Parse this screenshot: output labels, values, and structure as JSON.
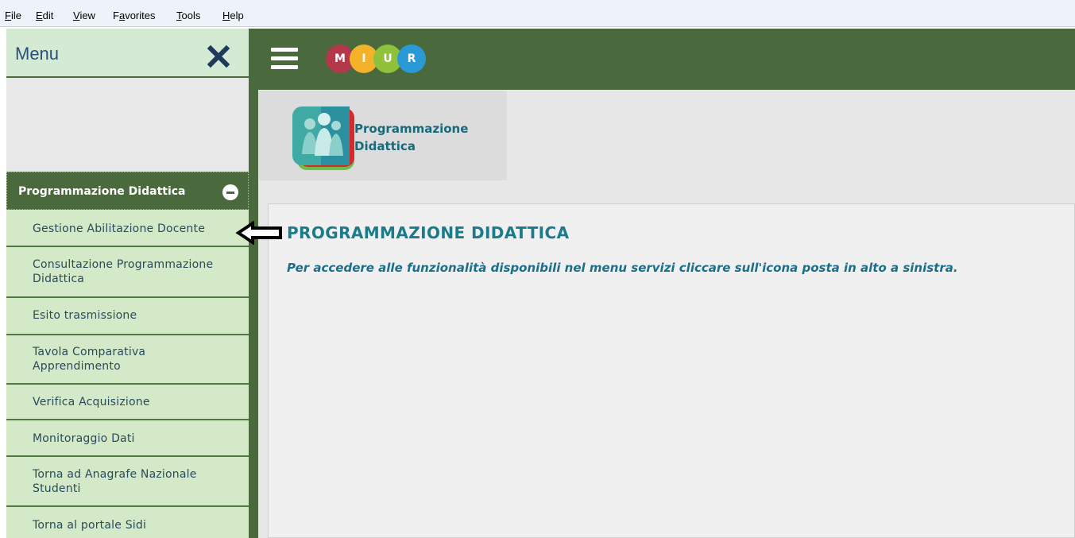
{
  "browser_menu": {
    "items": [
      {
        "accel": "F",
        "rest": "ile"
      },
      {
        "accel": "E",
        "rest": "dit"
      },
      {
        "accel": "V",
        "rest": "iew"
      },
      {
        "pre": "F",
        "accel": "a",
        "rest": "vorites"
      },
      {
        "accel": "T",
        "rest": "ools"
      },
      {
        "accel": "H",
        "rest": "elp"
      }
    ]
  },
  "sidebar": {
    "title": "Menu",
    "close_icon": "close-x-icon",
    "section": {
      "label": "Programmazione Didattica",
      "toggle_icon": "collapse-minus-icon"
    },
    "items": [
      {
        "label": "Gestione Abilitazione Docente"
      },
      {
        "label": "Consultazione Programmazione Didattica"
      },
      {
        "label": "Esito trasmissione"
      },
      {
        "label": "Tavola Comparativa Apprendimento"
      },
      {
        "label": "Verifica Acquisizione"
      },
      {
        "label": "Monitoraggio Dati"
      },
      {
        "label": "Torna ad Anagrafe Nazionale Studenti"
      },
      {
        "label": "Torna al portale Sidi"
      }
    ]
  },
  "header": {
    "menu_icon": "hamburger-icon",
    "logo_letters": [
      "M",
      "I",
      "U",
      "R"
    ],
    "logo_colors": [
      "#b3384b",
      "#f2b22a",
      "#8fc13a",
      "#2a9ad6"
    ]
  },
  "app": {
    "title_line1": "Programmazione",
    "title_line2": "Didattica",
    "icon": "people-app-icon"
  },
  "main": {
    "heading": "PROGRAMMAZIONE DIDATTICA",
    "instruction": "Per accedere alle funzionalità disponibili nel menu servizi cliccare sull'icona posta in alto a sinistra."
  },
  "colors": {
    "dark_green": "#4a6a3d",
    "light_green": "#d3e9c7",
    "teal_text": "#1b7b8a"
  }
}
